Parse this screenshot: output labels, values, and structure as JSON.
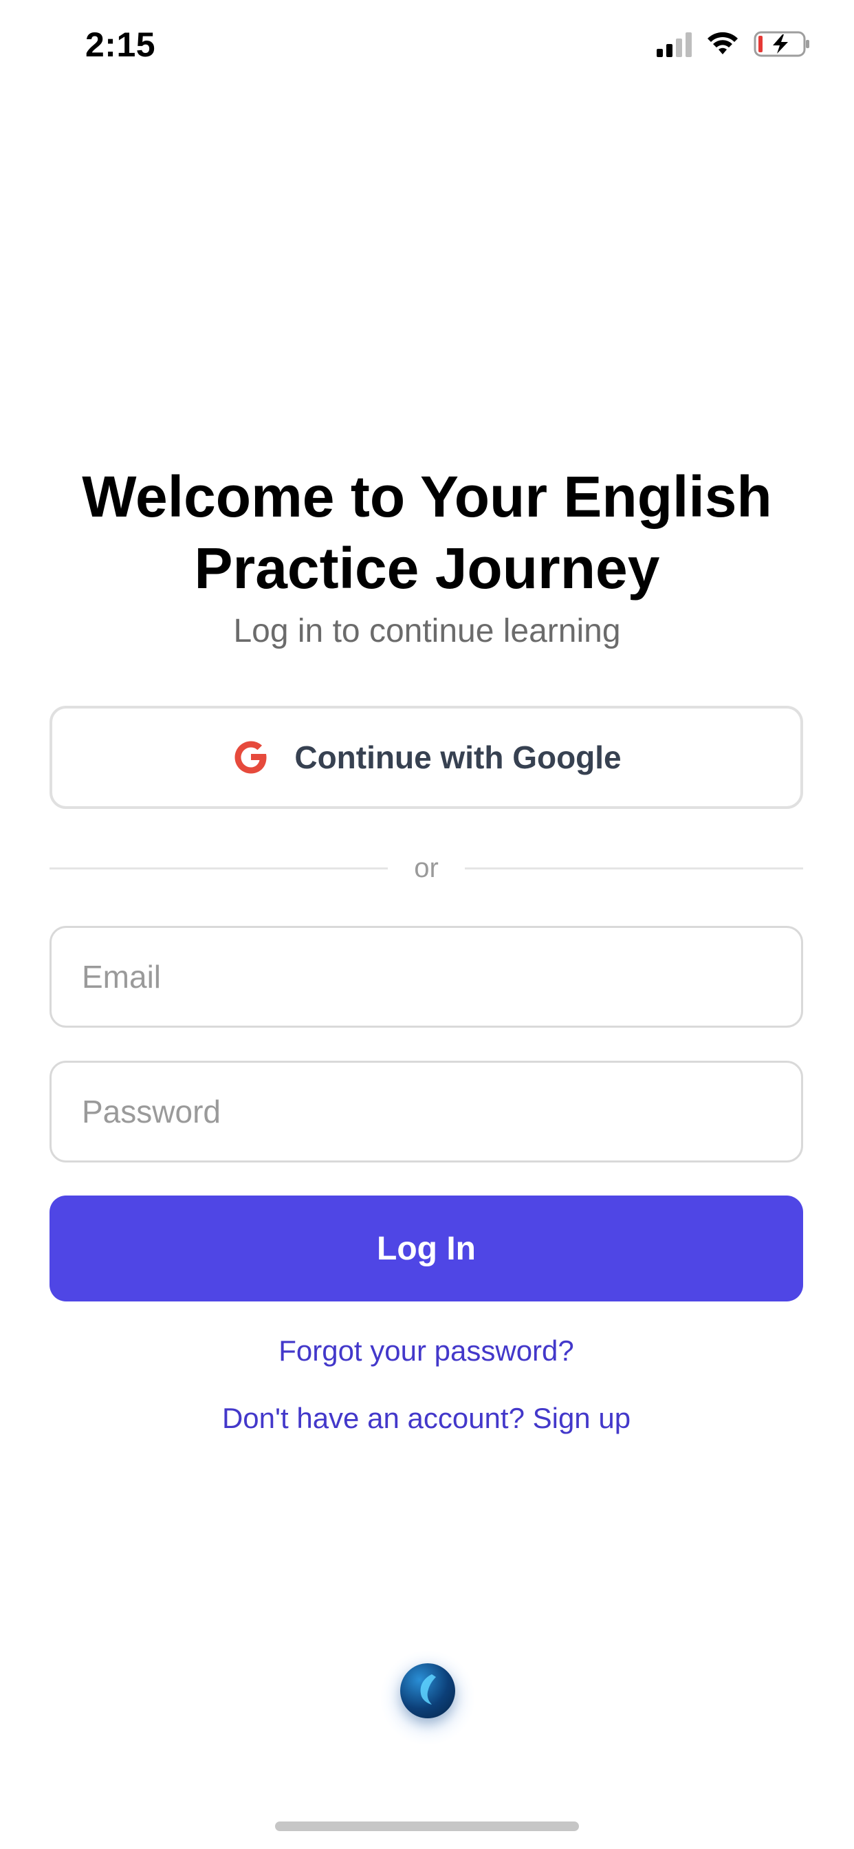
{
  "status_bar": {
    "time": "2:15",
    "icons": [
      "cellular-signal-icon",
      "wifi-icon",
      "battery-charging-icon"
    ],
    "battery_low_color": "#e53935"
  },
  "header": {
    "title": "Welcome to Your English Practice Journey",
    "subtitle": "Log in to continue learning"
  },
  "google_button": {
    "label": "Continue with Google",
    "icon": "google-g-icon",
    "icon_color": "#e64a3c"
  },
  "divider": {
    "label": "or"
  },
  "form": {
    "email_placeholder": "Email",
    "password_placeholder": "Password",
    "login_label": "Log In"
  },
  "links": {
    "forgot_password": "Forgot your password?",
    "signup": "Don't have an account? Sign up"
  },
  "colors": {
    "primary": "#4f46e5",
    "link": "#4338ca",
    "text_muted": "#6b6b6b"
  }
}
